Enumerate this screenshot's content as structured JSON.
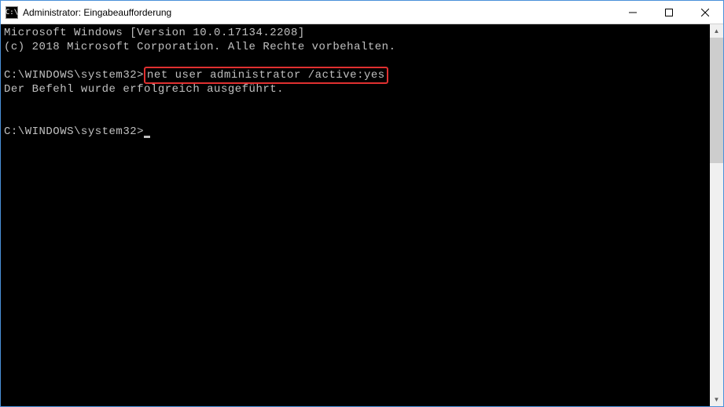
{
  "window": {
    "icon_text": "C:\\",
    "title": "Administrator: Eingabeaufforderung"
  },
  "terminal": {
    "line1": "Microsoft Windows [Version 10.0.17134.2208]",
    "line2": "(c) 2018 Microsoft Corporation. Alle Rechte vorbehalten.",
    "prompt1": "C:\\WINDOWS\\system32>",
    "command1": "net user administrator /active:yes",
    "result1": "Der Befehl wurde erfolgreich ausgeführt.",
    "prompt2": "C:\\WINDOWS\\system32>"
  }
}
